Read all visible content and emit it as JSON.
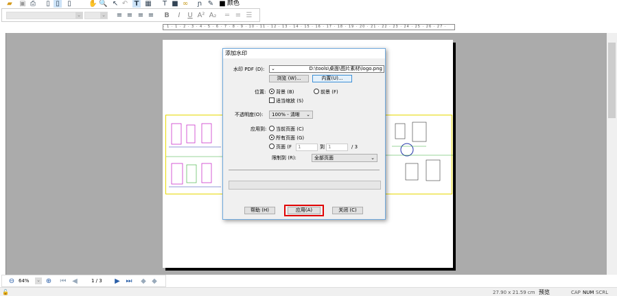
{
  "toolbar": {
    "color_label": "颜色"
  },
  "ruler": {
    "ticks": "· 1 · 1 · 2 · 3 · 4 · 5 · 6 · 7 · 8 · 9 · 10 · 11 · 12 · 13 · 14 · 15 · 16 · 17 · 18 · 19 · 20 · 21 · 22 · 23 · 24 · 25 · 26 · 27 ·"
  },
  "dialog": {
    "title": "添加水印",
    "watermark_label": "水印 PDF (D):",
    "watermark_path": "D:\\tools\\桌面\\图片素材\\logo.png",
    "browse_button": "浏览 (W)...",
    "builtin_button": "内置(U)...",
    "position_label": "位置:",
    "background_option": "背景 (B)",
    "foreground_option": "前景 (F)",
    "fit_scale_label": "适当缩放 (S)",
    "opacity_label": "不透明度(O):",
    "opacity_value": "100% - 清晰",
    "apply_to_label": "应用到:",
    "current_page_option": "当前页面 (C)",
    "all_pages_option": "所有页面 (G)",
    "pages_option": "页面 (F",
    "page_from": "1",
    "to_label": "到",
    "page_to": "1",
    "page_total": "/ 3",
    "limit_label": "限制到 (R):",
    "limit_value": "全部页面",
    "help_button": "帮助 (H)",
    "apply_button": "应用(A)",
    "close_button": "关闭 (C)"
  },
  "navigation": {
    "zoom": "64%",
    "page": "1 / 3"
  },
  "status": {
    "page_size": "27.90 x 21.59 cm",
    "mode": "预览",
    "cap": "CAP",
    "num": "NUM",
    "scrl": "SCRL"
  },
  "colors": {
    "highlight": "#e00000",
    "accent": "#6fa8dc"
  }
}
